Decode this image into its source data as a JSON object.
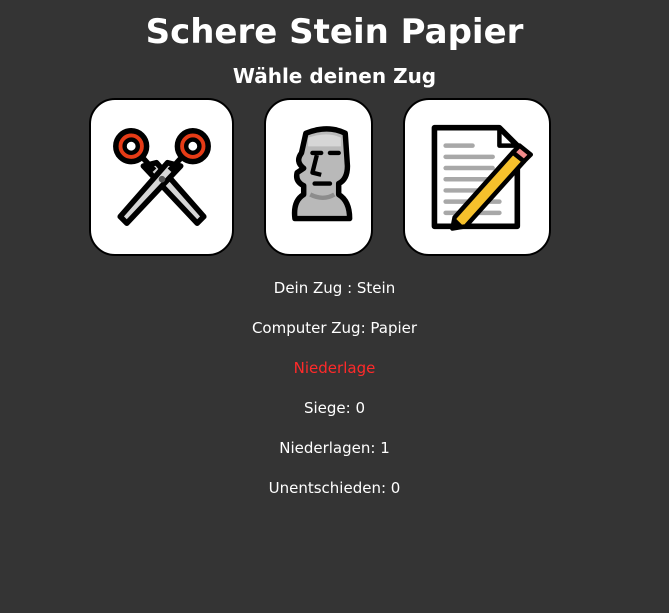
{
  "title": "Schere Stein Papier",
  "subtitle": "Wähle deinen Zug",
  "choices": [
    {
      "name": "Schere",
      "icon": "scissors-icon"
    },
    {
      "name": "Stein",
      "icon": "moai-icon"
    },
    {
      "name": "Papier",
      "icon": "memo-icon"
    }
  ],
  "result": {
    "player_move": "Dein Zug : Stein",
    "computer_move": "Computer Zug: Papier",
    "outcome": "Niederlage",
    "wins": "Siege: 0",
    "losses": "Niederlagen: 1",
    "draws": "Unentschieden: 0"
  },
  "colors": {
    "background": "#343434",
    "text": "#ffffff",
    "outcome_loss": "#ff2a2a"
  }
}
